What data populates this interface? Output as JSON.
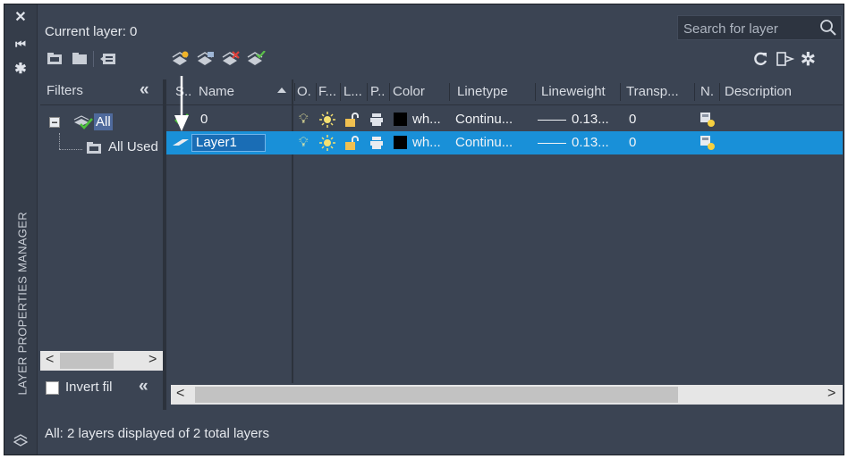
{
  "palette": {
    "window_bg": "#3b4453",
    "selection_blue": "#1990d8",
    "text": "#e6e9ee"
  },
  "header": {
    "current_layer": "Current layer: 0"
  },
  "search": {
    "placeholder": "Search for layer"
  },
  "sidebar": {
    "title": "LAYER PROPERTIES MANAGER",
    "icons": [
      "close-icon",
      "auto-hide-icon",
      "properties-icon"
    ]
  },
  "filters": {
    "title": "Filters",
    "collapse_glyph": "«",
    "tree": [
      {
        "label": "All",
        "selected": true
      },
      {
        "label": "All Used Layers",
        "selected": false
      }
    ],
    "invert_label": "Invert fil",
    "invert_checked": false,
    "invert_collapse_glyph": "«"
  },
  "grid": {
    "columns": [
      "S..",
      "Name",
      "O.",
      "F...",
      "L...",
      "P..",
      "Color",
      "Linetype",
      "Lineweight",
      "Transp...",
      "N.",
      "Description"
    ],
    "rows": [
      {
        "name": "0",
        "color": "wh...",
        "linetype": "Continu...",
        "lineweight": "0.13...",
        "transparency": "0",
        "current": true,
        "selected": false
      },
      {
        "name": "Layer1",
        "color": "wh...",
        "linetype": "Continu...",
        "lineweight": "0.13...",
        "transparency": "0",
        "current": false,
        "selected": true
      }
    ]
  },
  "status": {
    "text": "All: 2 layers displayed of 2 total layers"
  }
}
